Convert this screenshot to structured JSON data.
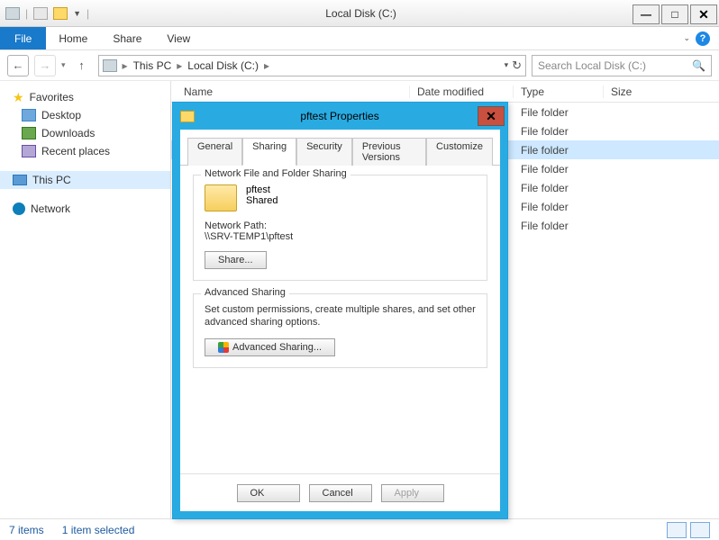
{
  "window": {
    "title": "Local Disk (C:)"
  },
  "menubar": {
    "file": "File",
    "items": [
      "Home",
      "Share",
      "View"
    ]
  },
  "breadcrumb": {
    "root": "This PC",
    "drive": "Local Disk (C:)"
  },
  "search": {
    "placeholder": "Search Local Disk (C:)"
  },
  "sidebar": {
    "favorites": {
      "label": "Favorites",
      "items": [
        "Desktop",
        "Downloads",
        "Recent places"
      ]
    },
    "thispc": "This PC",
    "network": "Network"
  },
  "columns": {
    "name": "Name",
    "date": "Date modified",
    "type": "Type",
    "size": "Size"
  },
  "rows": [
    {
      "type": "File folder"
    },
    {
      "type": "File folder"
    },
    {
      "type": "File folder",
      "selected": true
    },
    {
      "type": "File folder"
    },
    {
      "type": "File folder"
    },
    {
      "type": "File folder"
    },
    {
      "type": "File folder"
    }
  ],
  "status": {
    "count": "7 items",
    "selected": "1 item selected"
  },
  "dialog": {
    "title": "pftest Properties",
    "tabs": [
      "General",
      "Sharing",
      "Security",
      "Previous Versions",
      "Customize"
    ],
    "activeTab": 1,
    "network_group": {
      "title": "Network File and Folder Sharing",
      "folder_name": "pftest",
      "status": "Shared",
      "path_label": "Network Path:",
      "path_value": "\\\\SRV-TEMP1\\pftest",
      "share_btn": "Share..."
    },
    "advanced_group": {
      "title": "Advanced Sharing",
      "desc": "Set custom permissions, create multiple shares, and set other advanced sharing options.",
      "btn": "Advanced Sharing..."
    },
    "buttons": {
      "ok": "OK",
      "cancel": "Cancel",
      "apply": "Apply"
    }
  }
}
